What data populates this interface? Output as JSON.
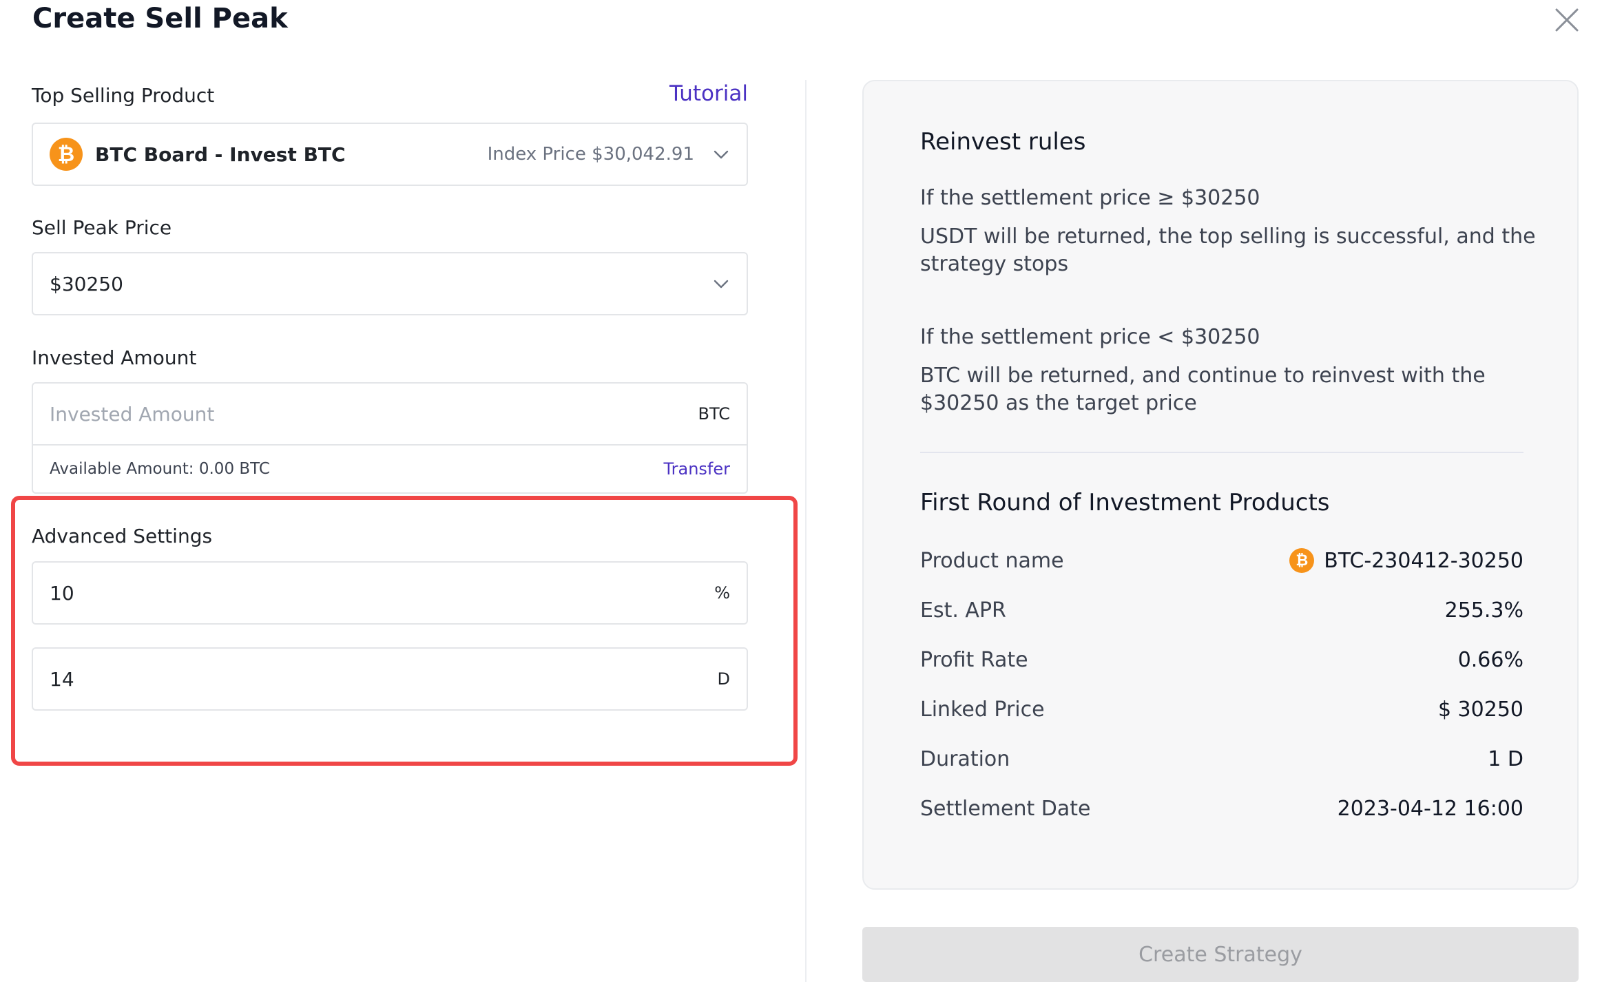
{
  "modal": {
    "title": "Create Sell Peak"
  },
  "product": {
    "label": "Top Selling Product",
    "tutorial": "Tutorial",
    "coin_symbol": "₿",
    "name": "BTC Board - Invest BTC",
    "index_price": "Index Price $30,042.91"
  },
  "sell_peak": {
    "label": "Sell Peak Price",
    "value": "$30250"
  },
  "invested": {
    "label": "Invested Amount",
    "placeholder": "Invested Amount",
    "unit": "BTC",
    "available": "Available Amount: 0.00 BTC",
    "transfer": "Transfer"
  },
  "advanced": {
    "label": "Advanced Settings",
    "field1_value": "10",
    "field1_unit": "%",
    "field2_value": "14",
    "field2_unit": "D"
  },
  "rules": {
    "heading": "Reinvest rules",
    "cond1": "If the settlement price ≥ $30250",
    "desc1": "USDT will be returned, the top selling is successful, and the strategy stops",
    "cond2": "If the settlement price < $30250",
    "desc2": "BTC will be returned, and continue to reinvest with the $30250 as the target price"
  },
  "first_round": {
    "heading": "First Round of Investment Products",
    "rows": [
      {
        "key": "Product name",
        "value": "BTC-230412-30250"
      },
      {
        "key": "Est. APR",
        "value": "255.3%"
      },
      {
        "key": "Profit Rate",
        "value": "0.66%"
      },
      {
        "key": "Linked Price",
        "value": "$ 30250"
      },
      {
        "key": "Duration",
        "value": "1 D"
      },
      {
        "key": "Settlement Date",
        "value": "2023-04-12 16:00"
      }
    ]
  },
  "actions": {
    "create": "Create Strategy"
  },
  "colors": {
    "accent": "#4b32c3",
    "btc": "#f7931a",
    "highlight": "#f04646",
    "disabled_button": "#e2e2e3"
  },
  "icons": {
    "close": "close-icon",
    "chevron": "chevron-down-icon",
    "coin": "btc-coin-icon"
  }
}
